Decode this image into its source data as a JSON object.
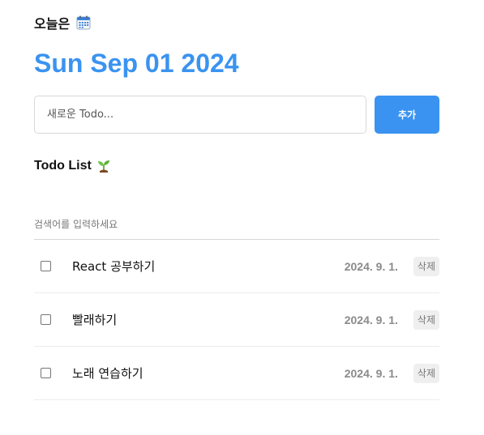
{
  "header": {
    "label": "오늘은",
    "calendar_icon": "calendar-icon",
    "date": "Sun Sep 01 2024"
  },
  "editor": {
    "placeholder": "새로운 Todo...",
    "value": "",
    "add_label": "추가"
  },
  "list": {
    "title": "Todo List",
    "title_icon": "sprout-icon",
    "search_placeholder": "검색어를 입력하세요",
    "items": [
      {
        "checked": false,
        "content": "React 공부하기",
        "date": "2024. 9. 1.",
        "delete_label": "삭제"
      },
      {
        "checked": false,
        "content": "빨래하기",
        "date": "2024. 9. 1.",
        "delete_label": "삭제"
      },
      {
        "checked": false,
        "content": "노래 연습하기",
        "date": "2024. 9. 1.",
        "delete_label": "삭제"
      }
    ]
  },
  "colors": {
    "accent": "#3a93f0",
    "delete_bg": "#efefef",
    "date_text": "#8a8a8a"
  }
}
